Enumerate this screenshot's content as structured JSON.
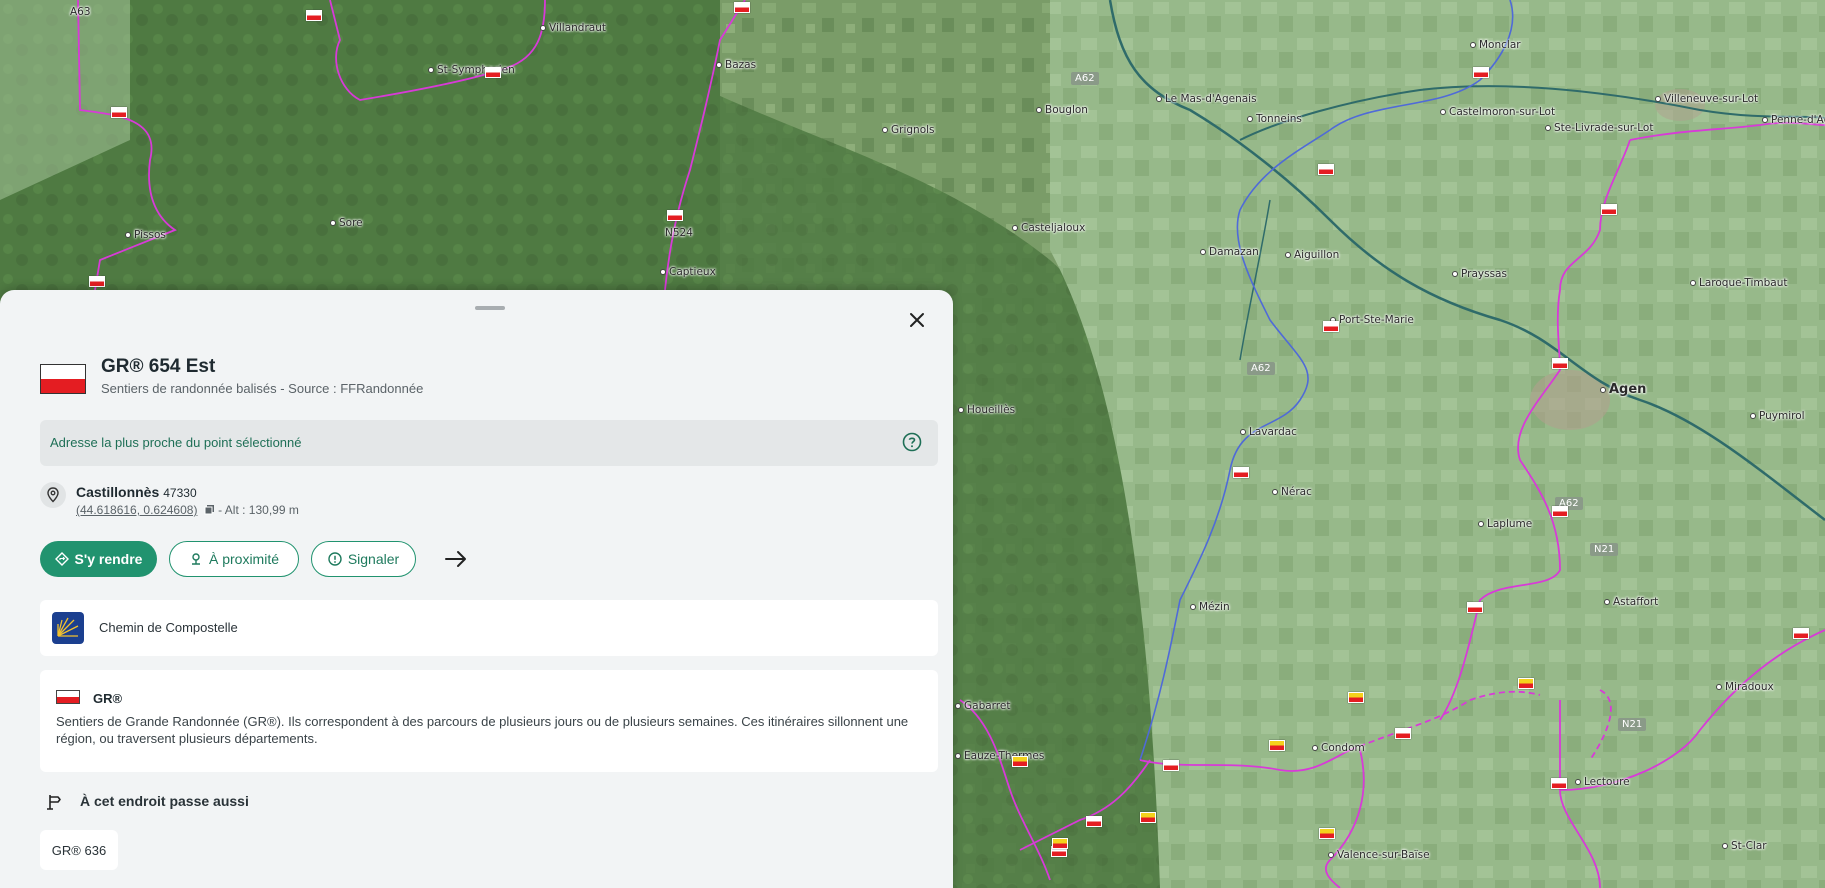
{
  "map": {
    "places": [
      {
        "name": "A63"
      },
      {
        "name": "Villandraut"
      },
      {
        "name": "St-Symphorien"
      },
      {
        "name": "Bazas"
      },
      {
        "name": "Grignols"
      },
      {
        "name": "Bouglon"
      },
      {
        "name": "Le Mas-d'Agenais"
      },
      {
        "name": "Tonneins"
      },
      {
        "name": "Monclar"
      },
      {
        "name": "Castelmoron-sur-Lot"
      },
      {
        "name": "Ste-Livrade-sur-Lot"
      },
      {
        "name": "Villeneuve-sur-Lot"
      },
      {
        "name": "Penne-d'Agenais"
      },
      {
        "name": "Sore"
      },
      {
        "name": "Pissos"
      },
      {
        "name": "N524"
      },
      {
        "name": "Captieux"
      },
      {
        "name": "Casteljaloux"
      },
      {
        "name": "Damazan"
      },
      {
        "name": "Aiguillon"
      },
      {
        "name": "Prayssas"
      },
      {
        "name": "Laroque-Timbaut"
      },
      {
        "name": "Port-Ste-Marie"
      },
      {
        "name": "Agen"
      },
      {
        "name": "Houeillès"
      },
      {
        "name": "Lavardac"
      },
      {
        "name": "Puymirol"
      },
      {
        "name": "Nérac"
      },
      {
        "name": "Laplume"
      },
      {
        "name": "Astaffort"
      },
      {
        "name": "Mézin"
      },
      {
        "name": "Gabarret"
      },
      {
        "name": "Miradoux"
      },
      {
        "name": "Eauze-Thermes"
      },
      {
        "name": "Condom"
      },
      {
        "name": "Lectoure"
      },
      {
        "name": "Valence-sur-Baïse"
      },
      {
        "name": "St-Clar"
      }
    ],
    "roads": [
      "A62",
      "A62",
      "A62",
      "N21",
      "N21"
    ]
  },
  "panel": {
    "title": "GR® 654 Est",
    "subtitle": "Sentiers de randonnée balisés - Source : FFRandonnée",
    "address_label": "Adresse la plus proche du point sélectionné",
    "place_name": "Castillonnès",
    "postal_code": "47330",
    "coords": "(44.618616, 0.624608)",
    "altitude": "- Alt : 130,99 m",
    "buttons": {
      "go": "S'y rendre",
      "nearby": "À proximité",
      "report": "Signaler"
    },
    "chemin": "Chemin de Compostelle",
    "gr_title": "GR®",
    "gr_desc": "Sentiers de Grande Randonnée (GR®). Ils correspondent à des parcours de plusieurs jours ou de plusieurs semaines. Ces itinéraires sillonnent une région, ou traversent plusieurs départements.",
    "passe_label": "À cet endroit passe aussi",
    "chip": "GR® 636"
  },
  "colors": {
    "accent": "#21936f",
    "gr_route": "#d83ad8",
    "river_route": "#4f6ad8",
    "flag_red": "#e41d22",
    "flag_yellow": "#f4d21c"
  }
}
